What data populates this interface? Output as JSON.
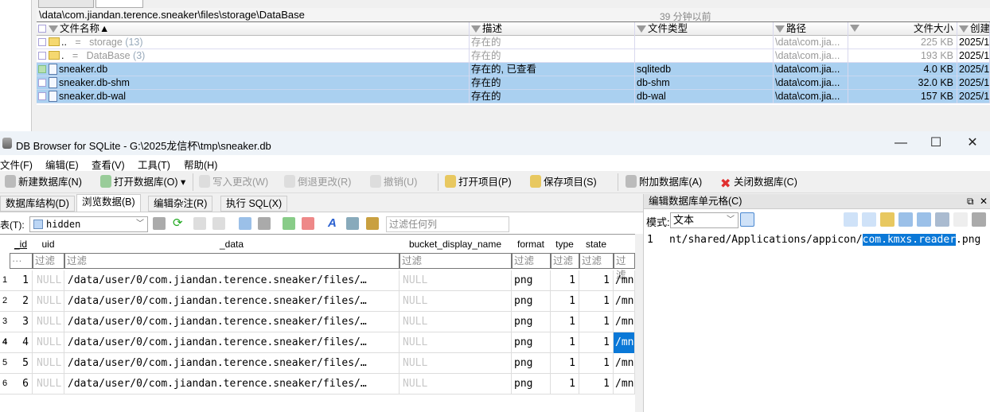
{
  "explorer": {
    "path": "\\data\\com.jiandan.terence.sneaker\\files\\storage\\DataBase",
    "modified_ago": "39 分钟以前",
    "columns": [
      "文件名称",
      "描述",
      "文件类型",
      "路径",
      "文件大小",
      "创建"
    ],
    "rows": [
      {
        "name": "..",
        "eq": "=",
        "label": "storage",
        "count": "(13)",
        "desc": "存在的",
        "type": "",
        "path": "\\data\\com.jia...",
        "size": "225 KB",
        "created": "2025/1",
        "kind": "folder"
      },
      {
        "name": ".",
        "eq": "=",
        "label": "DataBase",
        "count": "(3)",
        "desc": "存在的",
        "type": "",
        "path": "\\data\\com.jia...",
        "size": "193 KB",
        "created": "2025/1",
        "kind": "folder"
      },
      {
        "name": "sneaker.db",
        "desc": "存在的, 已查看",
        "type": "sqlitedb",
        "path": "\\data\\com.jia...",
        "size": "4.0 KB",
        "created": "2025/1",
        "kind": "file"
      },
      {
        "name": "sneaker.db-shm",
        "desc": "存在的",
        "type": "db-shm",
        "path": "\\data\\com.jia...",
        "size": "32.0 KB",
        "created": "2025/1",
        "kind": "file"
      },
      {
        "name": "sneaker.db-wal",
        "desc": "存在的",
        "type": "db-wal",
        "path": "\\data\\com.jia...",
        "size": "157 KB",
        "created": "2025/1",
        "kind": "file"
      }
    ]
  },
  "window": {
    "title": "DB Browser for SQLite - G:\\2025龙信杯\\tmp\\sneaker.db",
    "minimize": "—",
    "maximize": "☐",
    "close": "✕"
  },
  "menu": [
    "文件(F)",
    "编辑(E)",
    "查看(V)",
    "工具(T)",
    "帮助(H)"
  ],
  "toolbar": [
    "新建数据库(N)",
    "打开数据库(O)",
    "写入更改(W)",
    "倒退更改(R)",
    "撤销(U)",
    "打开项目(P)",
    "保存项目(S)",
    "附加数据库(A)",
    "关闭数据库(C)"
  ],
  "tabs": [
    "数据库结构(D)",
    "浏览数据(B)",
    "编辑杂注(R)",
    "执行 SQL(X)"
  ],
  "browse": {
    "table_label": "表(T):",
    "table": "hidden",
    "filter_placeholder": "过滤任何列"
  },
  "grid": {
    "columns": [
      "_id",
      "uid",
      "_data",
      "bucket_display_name",
      "format",
      "type",
      "state"
    ],
    "filter": "过滤",
    "filter_first": "···",
    "rows": [
      {
        "n": "1",
        "id": "1",
        "uid": "NULL",
        "data": "/data/user/0/com.jiandan.terence.sneaker/files/…",
        "bucket": "NULL",
        "format": "png",
        "type": "1",
        "state": "1",
        "next": "/mn"
      },
      {
        "n": "2",
        "id": "2",
        "uid": "NULL",
        "data": "/data/user/0/com.jiandan.terence.sneaker/files/…",
        "bucket": "NULL",
        "format": "png",
        "type": "1",
        "state": "1",
        "next": "/mn"
      },
      {
        "n": "3",
        "id": "3",
        "uid": "NULL",
        "data": "/data/user/0/com.jiandan.terence.sneaker/files/…",
        "bucket": "NULL",
        "format": "png",
        "type": "1",
        "state": "1",
        "next": "/mn"
      },
      {
        "n": "4",
        "id": "4",
        "uid": "NULL",
        "data": "/data/user/0/com.jiandan.terence.sneaker/files/…",
        "bucket": "NULL",
        "format": "png",
        "type": "1",
        "state": "1",
        "next": "/mn"
      },
      {
        "n": "5",
        "id": "5",
        "uid": "NULL",
        "data": "/data/user/0/com.jiandan.terence.sneaker/files/…",
        "bucket": "NULL",
        "format": "png",
        "type": "1",
        "state": "1",
        "next": "/mn"
      },
      {
        "n": "6",
        "id": "6",
        "uid": "NULL",
        "data": "/data/user/0/com.jiandan.terence.sneaker/files/…",
        "bucket": "NULL",
        "format": "png",
        "type": "1",
        "state": "1",
        "next": "/mn"
      }
    ]
  },
  "editor": {
    "title": "编辑数据库单元格(C)",
    "mode_label": "模式:",
    "mode": "文本",
    "line": "1",
    "text_before": "nt/shared/Applications/appicon/",
    "text_selected": "com.kmxs.reader",
    "text_after": ".png"
  }
}
